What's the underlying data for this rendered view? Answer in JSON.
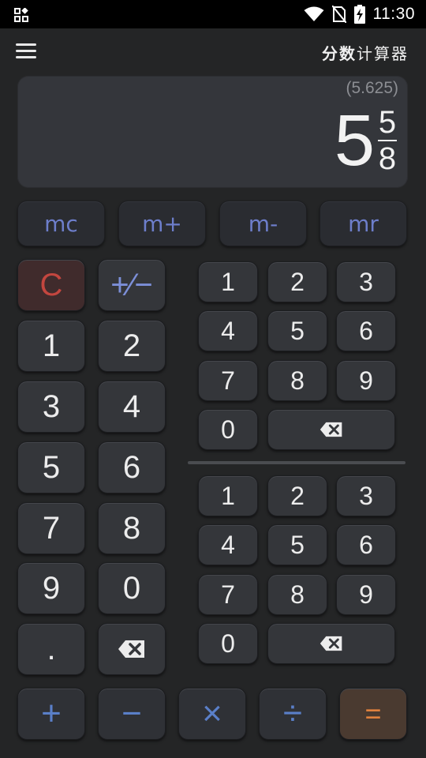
{
  "status_bar": {
    "time": "11:30",
    "icons": [
      "grid-icon",
      "wifi-icon",
      "no-sim-icon",
      "battery-charging-icon"
    ]
  },
  "header": {
    "title_bold": "分数",
    "title_rest": "计算器",
    "menu_icon": "hamburger-menu-icon"
  },
  "display": {
    "decimal": "(5.625)",
    "whole": "5",
    "numerator": "5",
    "denominator": "8"
  },
  "memory": {
    "mc": "mc",
    "m_plus": "m+",
    "m_minus": "m-",
    "mr": "mr"
  },
  "left_pad": {
    "clear": "C",
    "plus_minus": "+∕−",
    "digits": [
      "1",
      "2",
      "3",
      "4",
      "5",
      "6",
      "7",
      "8",
      "9",
      "0"
    ],
    "dot": "."
  },
  "numerator_pad": {
    "digits": [
      "1",
      "2",
      "3",
      "4",
      "5",
      "6",
      "7",
      "8",
      "9",
      "0"
    ]
  },
  "denominator_pad": {
    "digits": [
      "1",
      "2",
      "3",
      "4",
      "5",
      "6",
      "7",
      "8",
      "9",
      "0"
    ]
  },
  "operators": {
    "add": "+",
    "subtract": "−",
    "multiply": "×",
    "divide": "÷",
    "equals": "="
  },
  "colors": {
    "background": "#242526",
    "memory_text": "#6d7ecb",
    "clear_text": "#c3463f",
    "operator_text": "#5a7fc8",
    "equals_text": "#e0813d"
  }
}
